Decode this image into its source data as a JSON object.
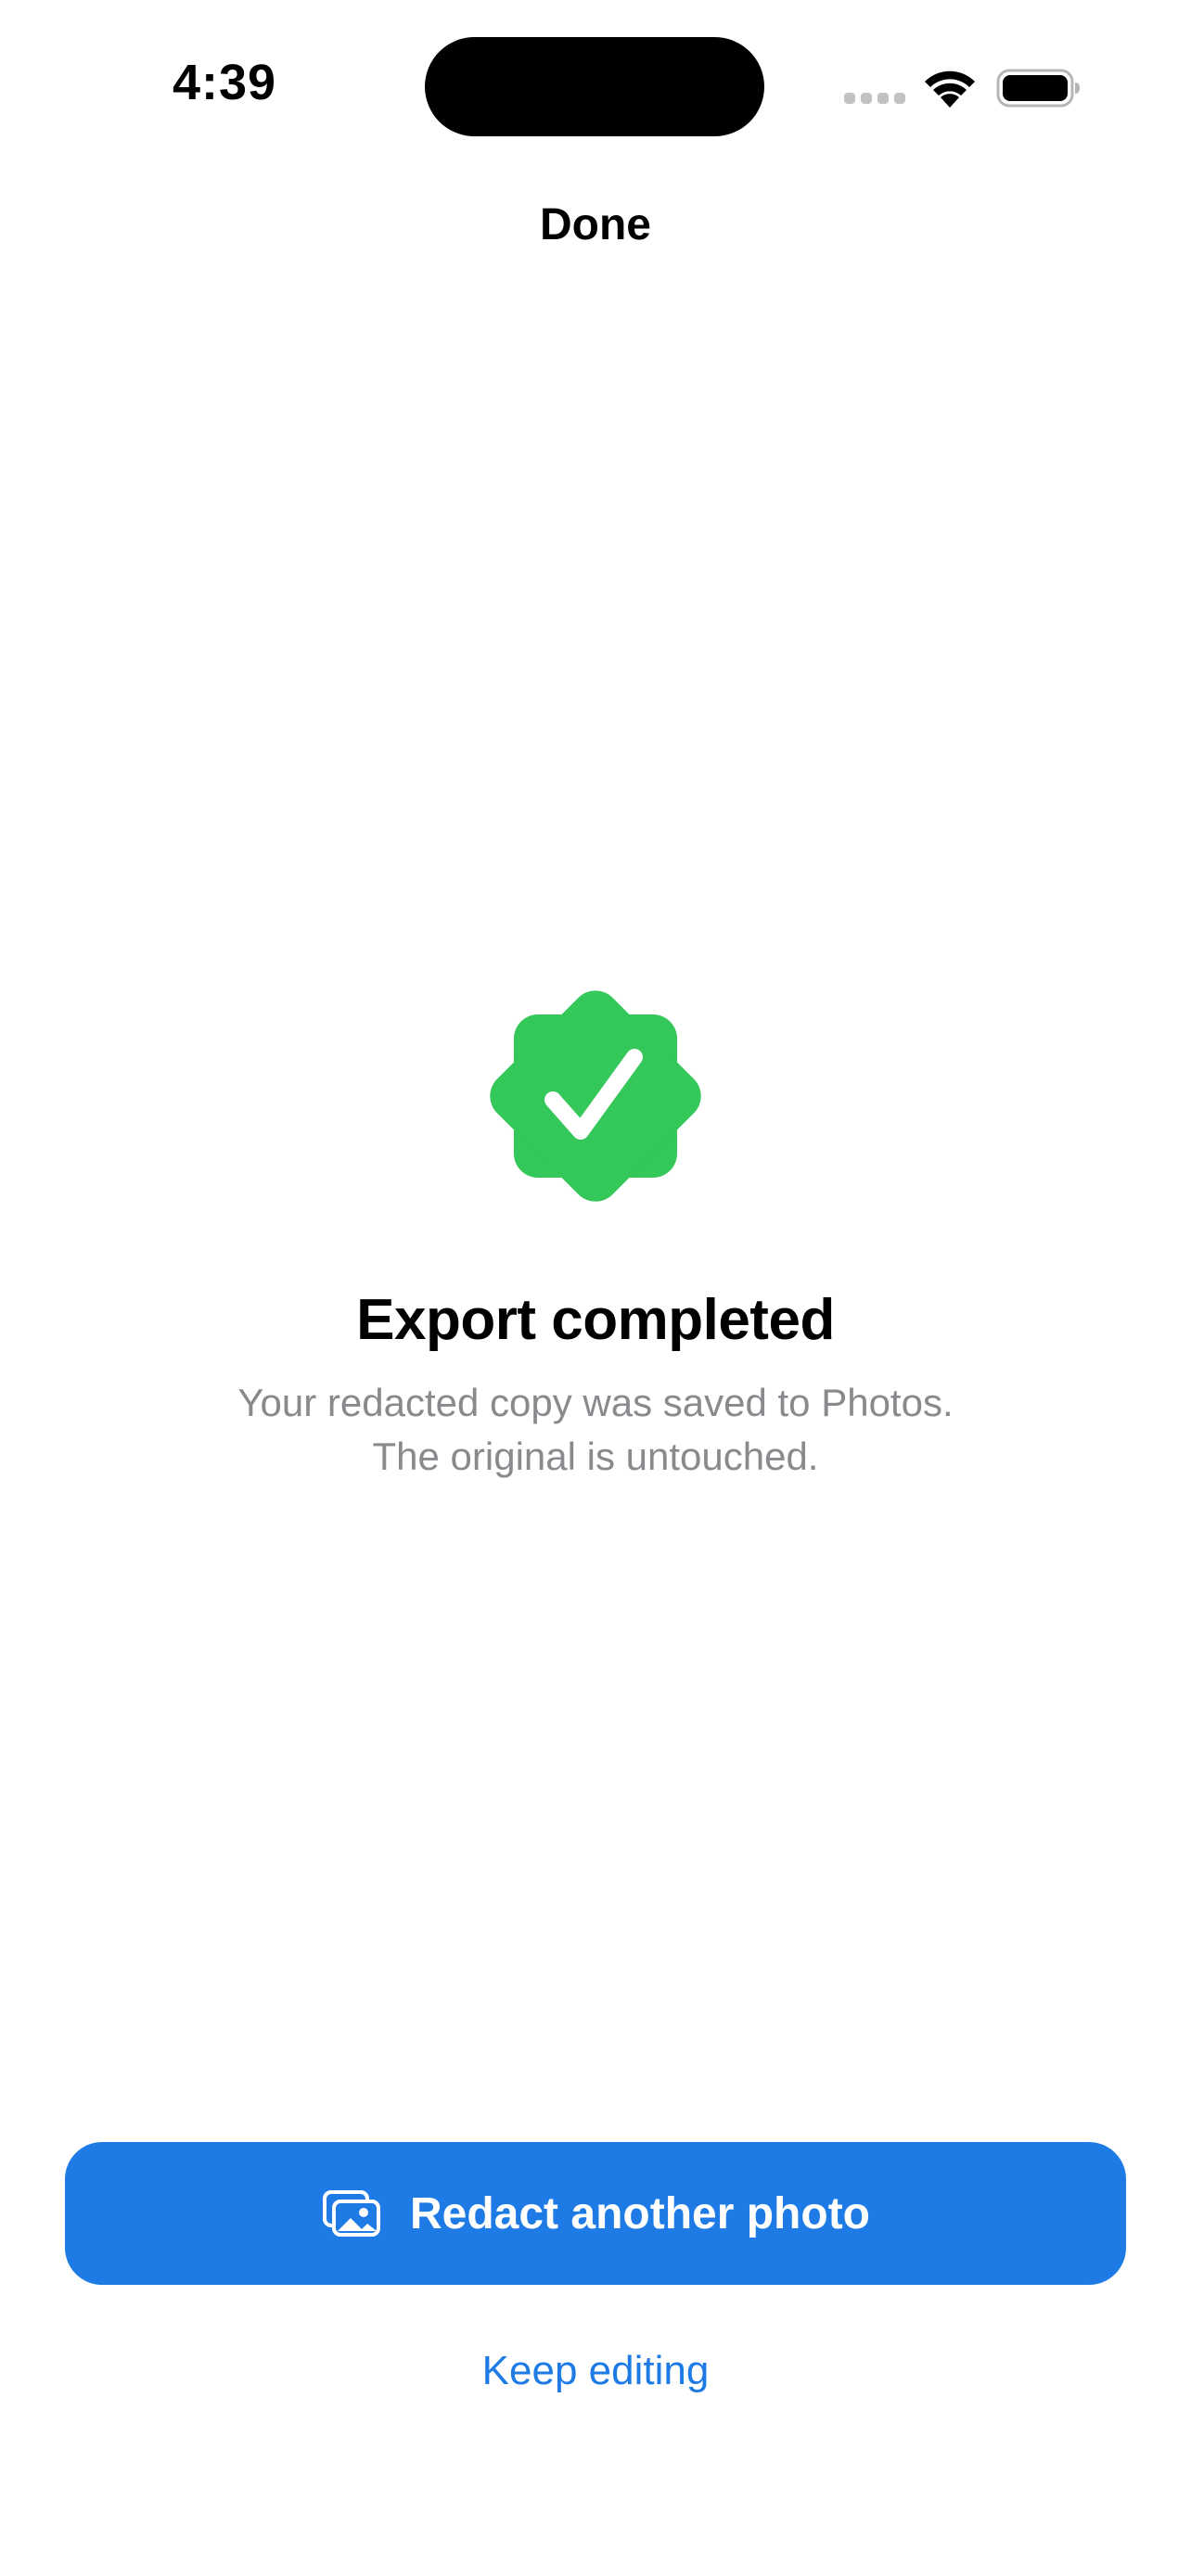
{
  "status_bar": {
    "time": "4:39",
    "signal_icon": "cellular-signal-icon",
    "wifi_icon": "wifi-icon",
    "battery_icon": "battery-icon"
  },
  "nav": {
    "title": "Done"
  },
  "success": {
    "icon": "checkmark-seal-icon",
    "icon_color": "#34c759",
    "title": "Export completed",
    "message_line1": "Your redacted copy was saved to Photos.",
    "message_line2": "The original is untouched."
  },
  "actions": {
    "primary_label": "Redact another photo",
    "primary_icon": "photos-stack-icon",
    "primary_color": "#1e7be6",
    "secondary_label": "Keep editing"
  }
}
